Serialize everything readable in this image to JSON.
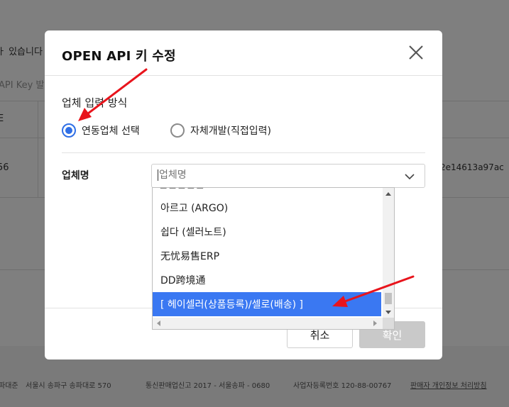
{
  "background": {
    "notice_text": "ㅏ 있습니다",
    "api_key_placeholder": "API Key 발",
    "table_header_cell": "E",
    "row_left_value": "56",
    "row_right_value": "2e14613a97ac",
    "footer": {
      "company_partial": "파대준",
      "address": "서울시 송파구 송파대로 570",
      "telecom_registration": "통신판매업신고 2017 - 서울송파 - 0680",
      "business_registration": "사업자등록번호 120-88-00767",
      "privacy_link": "판매자 개인정보 처리방침"
    }
  },
  "modal": {
    "title": "OPEN API 키 수정",
    "input_method_label": "업체 입력 방식",
    "radio_options": [
      {
        "label": "연동업체 선택",
        "checked": true
      },
      {
        "label": "자체개발(직접입력)",
        "checked": false
      }
    ],
    "company_name_label": "업체명",
    "company_select": {
      "placeholder": "업체명",
      "options": [
        "아르고 (ARGO)",
        "쉽다 (셀러노트)",
        "无忧易售ERP",
        "DD跨境通",
        "[ 헤이셀러(상품등록)/셀로(배송) ]"
      ],
      "highlighted_option": "[ 헤이셀러(상품등록)/셀로(배송) ]"
    },
    "cancel_label": "취소",
    "confirm_label": "확인"
  },
  "colors": {
    "accent": "#2f6fe6",
    "highlight": "#3a78f2",
    "annotation_arrow": "#e8141c",
    "confirm_disabled": "#c9c9c9"
  },
  "icons": {
    "close": "close-icon",
    "dropdown": "chevron-down-icon",
    "scroll_up": "scroll-up-arrow-icon",
    "scroll_down": "scroll-down-arrow-icon",
    "scroll_left": "scroll-left-arrow-icon",
    "scroll_right": "scroll-right-arrow-icon"
  }
}
